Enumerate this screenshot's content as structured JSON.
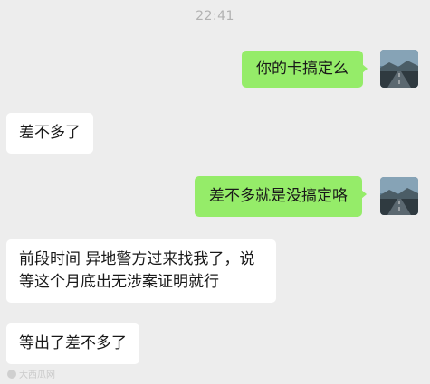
{
  "chat": {
    "timestamp": "22:41",
    "messages": [
      {
        "direction": "out",
        "text": "你的卡搞定么"
      },
      {
        "direction": "in",
        "text": "差不多了"
      },
      {
        "direction": "out",
        "text": "差不多就是没搞定咯"
      },
      {
        "direction": "in",
        "line1": "前段时间 异地警方过来找我了，说",
        "line2": "等这个月底出无涉案证明就行"
      },
      {
        "direction": "in",
        "text": "等出了差不多了"
      }
    ],
    "avatar_icon": "road-landscape-avatar-icon"
  },
  "watermark": {
    "text": "大西瓜网"
  },
  "colors": {
    "background": "#ededed",
    "outgoing_bubble": "#95ec69",
    "incoming_bubble": "#ffffff",
    "timestamp_text": "#b2b2b2"
  }
}
